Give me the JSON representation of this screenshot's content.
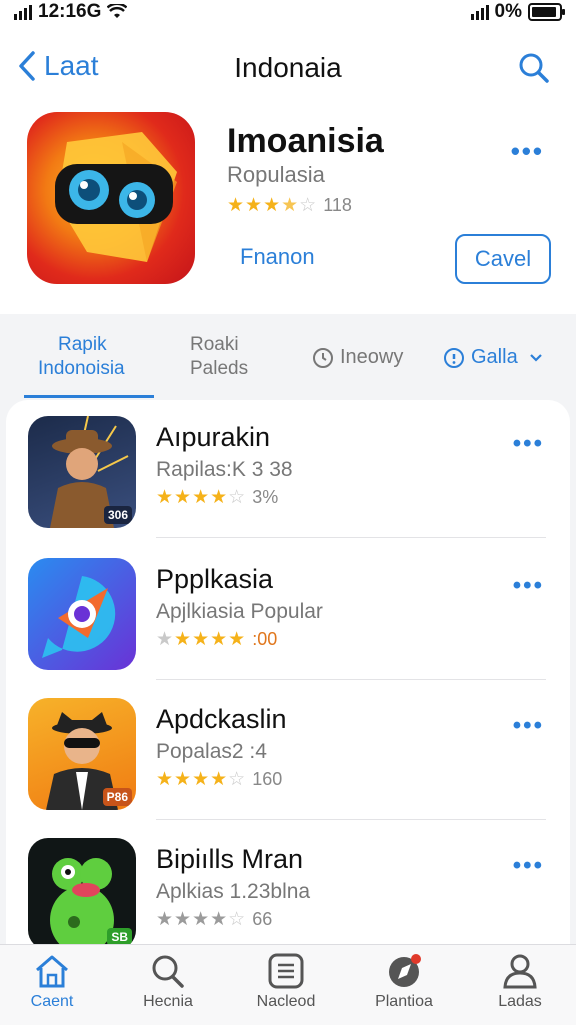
{
  "status_bar": {
    "carrier": "12:16G",
    "battery_percent": "0%"
  },
  "nav": {
    "back_label": "Laat",
    "title": "Indonaia"
  },
  "hero": {
    "name": "Imoanisia",
    "subtitle": "Ropulasia",
    "rating_count": "118",
    "rating_stars": 3.5,
    "link": "Fnanon",
    "button": "Cavel"
  },
  "tabs": [
    {
      "line1": "Rapik",
      "line2": "Indonoisia"
    },
    {
      "line1": "Roaki",
      "line2": "Paleds"
    },
    {
      "label": "Ineowy"
    },
    {
      "label": "Galla"
    }
  ],
  "apps": [
    {
      "name": "Aıpurakin",
      "subtitle": "Rapilas:K 3 38",
      "rating_text": "3%",
      "rating_stars": 3.5,
      "badge": "306",
      "colors": {
        "bg": "#2a3f66",
        "accent": "#8a5a2e"
      }
    },
    {
      "name": "Ppplkasia",
      "subtitle": "Apjlkiasia Popular",
      "rating_text": ":00",
      "rating_stars": 4,
      "colors": {
        "bg": "#5b38d8",
        "accent": "#2cc2f0"
      }
    },
    {
      "name": "Apdckaslin",
      "subtitle": "Popalas2 :4",
      "rating_text": "160",
      "rating_stars": 3.5,
      "badge": "P86",
      "colors": {
        "bg": "#f39a1d",
        "accent": "#222"
      }
    },
    {
      "name": "Bipiılls Mran",
      "subtitle": "Aplkias 1.23blna",
      "rating_text": "66",
      "rating_stars": 3.5,
      "badge": "SB",
      "colors": {
        "bg": "#101616",
        "accent": "#5fce3f"
      }
    }
  ],
  "tabbar": [
    {
      "label": "Caent",
      "icon": "home-icon",
      "active": true
    },
    {
      "label": "Hecnia",
      "icon": "search-icon"
    },
    {
      "label": "Nacleod",
      "icon": "list-icon"
    },
    {
      "label": "Plantioa",
      "icon": "compass-icon"
    },
    {
      "label": "Ladas",
      "icon": "person-icon"
    }
  ],
  "colors": {
    "accent": "#2b7fd8",
    "star": "#f5b21a"
  }
}
